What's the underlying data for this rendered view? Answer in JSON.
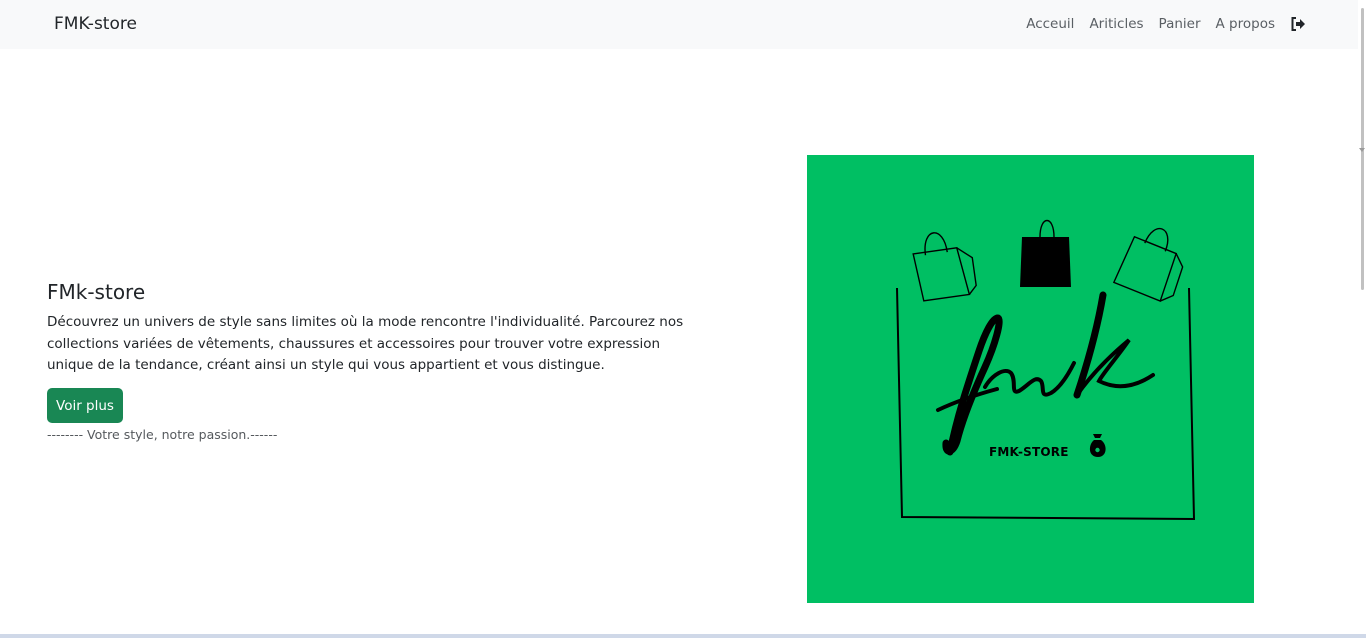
{
  "navbar": {
    "brand": "FMK-store",
    "links": [
      {
        "label": "Acceuil"
      },
      {
        "label": "Ariticles"
      },
      {
        "label": "Panier"
      },
      {
        "label": "A propos"
      }
    ],
    "logout_icon": "sign-out-icon"
  },
  "hero": {
    "title": "FMk-store",
    "description": "Découvrez un univers de style sans limites où la mode rencontre l'individualité. Parcourez nos collections variées de vêtements, chaussures et accessoires pour trouver votre expression unique de la tendance, créant ainsi un style qui vous appartient et vous distingue.",
    "button_label": "Voir plus",
    "tagline": "-------- Votre style, notre passion.------"
  },
  "logo": {
    "script_text": "fmk",
    "store_name": "FMK-STORE",
    "background_color": "#00bf63",
    "icons": [
      "shopping-bag-outline-icon",
      "shopping-bag-filled-icon",
      "shopping-bag-outline-icon",
      "money-bag-icon"
    ]
  },
  "colors": {
    "navbar_bg": "#f8f9fa",
    "button_bg": "#198754",
    "logo_bg": "#00bf63"
  }
}
